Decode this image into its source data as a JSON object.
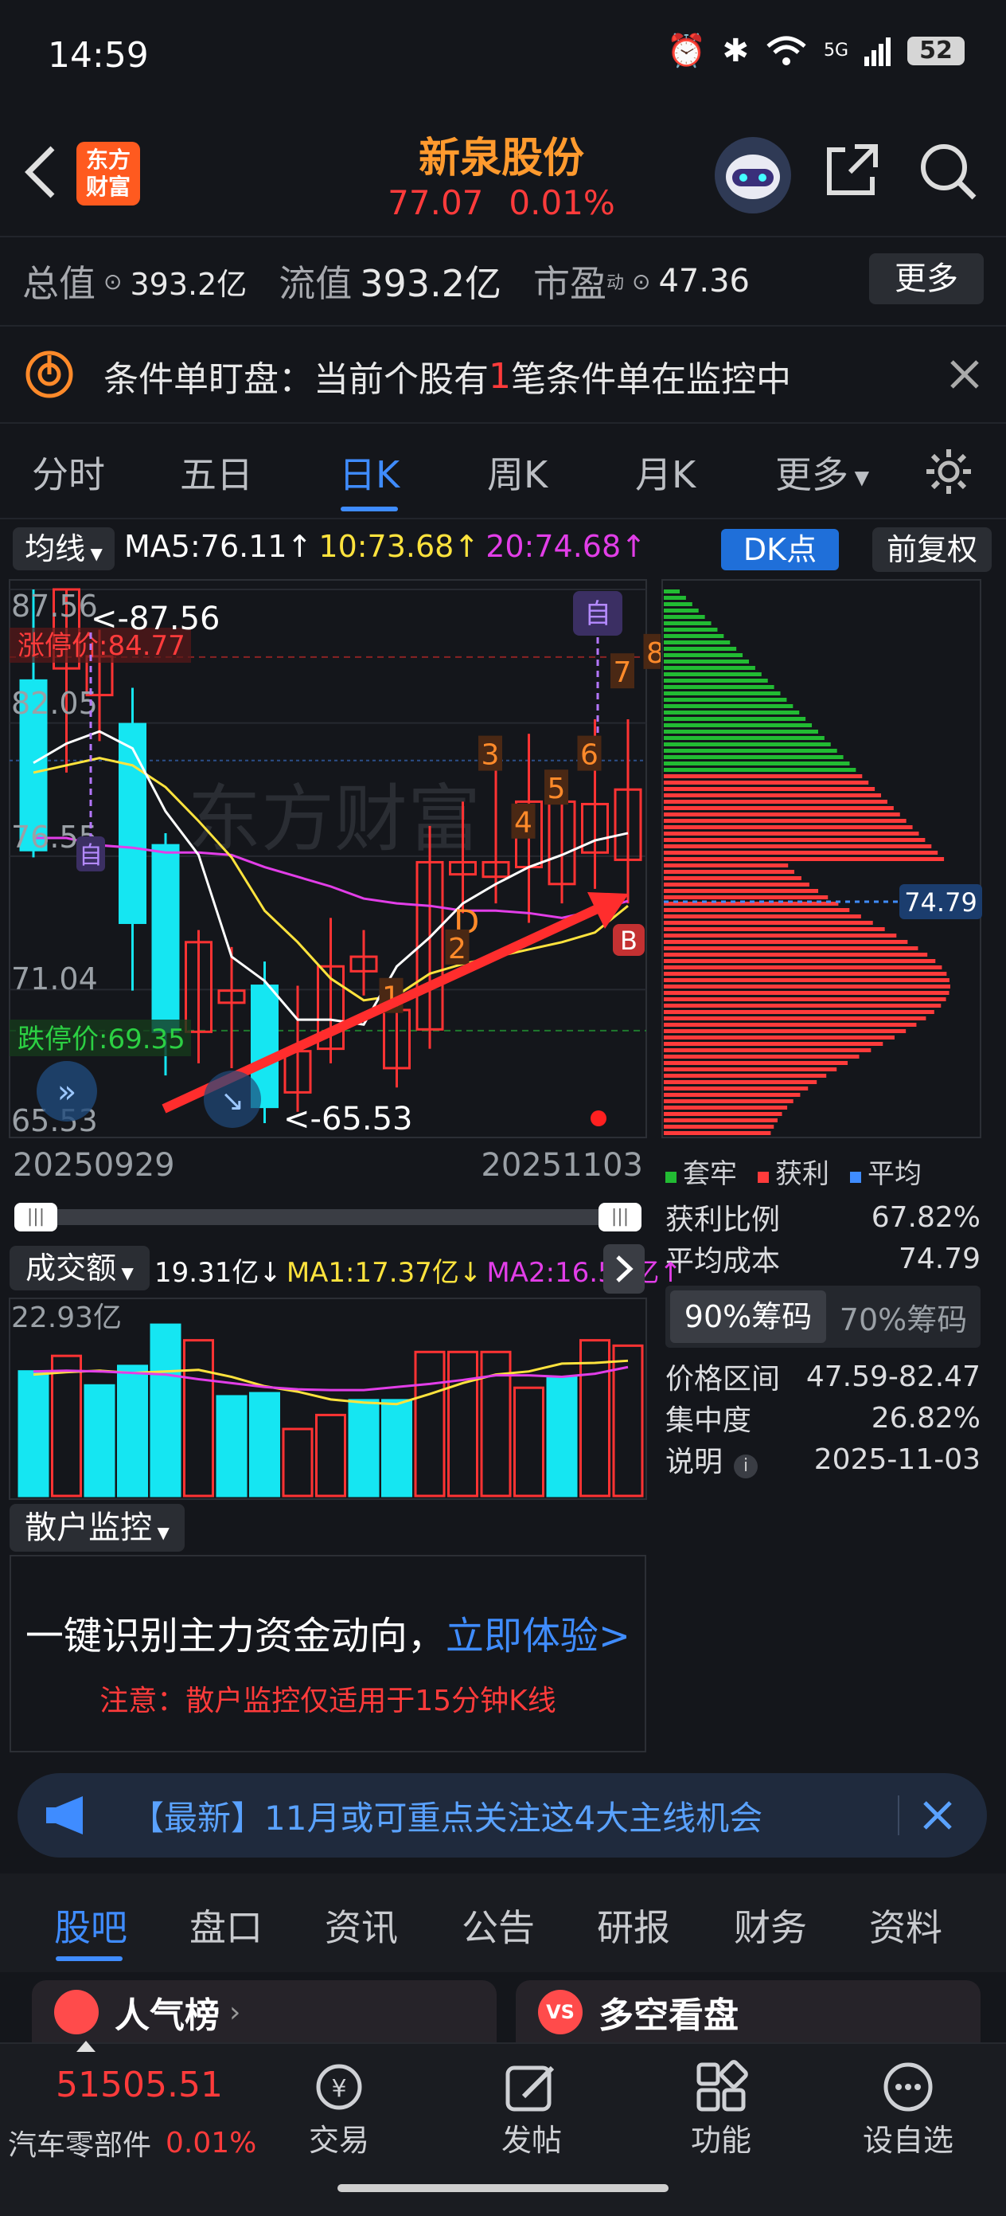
{
  "status_bar": {
    "time": "14:59",
    "battery": "52",
    "network": "5G"
  },
  "header": {
    "logo_text_top": "东方",
    "logo_text_bottom": "财富",
    "stock_name": "新泉股份",
    "price": "77.07",
    "change": "0.01%"
  },
  "stats": {
    "total_value_label": "总值",
    "total_value": "393.2亿",
    "float_value_label": "流值",
    "float_value": "393.2亿",
    "pe_label": "市盈",
    "pe_sup": "动",
    "pe_value": "47.36",
    "more_button": "更多"
  },
  "alert": {
    "text_prefix": "条件单盯盘：当前个股有",
    "count": "1",
    "text_suffix": "笔条件单在监控中"
  },
  "period_tabs": [
    "分时",
    "五日",
    "日K",
    "周K",
    "月K",
    "更多"
  ],
  "active_tab": 2,
  "ma_bar": {
    "ma_label": "均线",
    "ma5": "MA5:76.11↑",
    "ma10": "10:73.68↑",
    "ma20": "20:74.68↑",
    "dk_button": "DK点",
    "adjust_button": "前复权"
  },
  "kline": {
    "price_high": "87.56",
    "price_2": "82.05",
    "price_3": "76.55",
    "price_4": "71.04",
    "price_low": "65.53",
    "limit_up": "涨停价:84.77",
    "limit_down": "跌停价:69.35",
    "annot_high": "<-87.56",
    "annot_low": "<-65.53",
    "date_start": "20250929",
    "date_end": "20251103",
    "marker_zi": "自",
    "marker_d": "D",
    "marker_b": "B",
    "seq_labels": [
      "1",
      "2",
      "3",
      "4",
      "5",
      "6",
      "7",
      "8"
    ],
    "watermark": "东方财富"
  },
  "chart_data": {
    "type": "candlestick",
    "ylim": [
      65.53,
      87.56
    ],
    "candles": [
      {
        "o": 83.8,
        "h": 87.56,
        "l": 76.5,
        "c": 76.8
      },
      {
        "o": 84.3,
        "h": 87.56,
        "l": 80.0,
        "c": 87.56
      },
      {
        "o": 83.2,
        "h": 85.9,
        "l": 81.3,
        "c": 84.8
      },
      {
        "o": 82.0,
        "h": 83.5,
        "l": 71.0,
        "c": 73.8
      },
      {
        "o": 77.0,
        "h": 77.5,
        "l": 67.5,
        "c": 69.3
      },
      {
        "o": 69.3,
        "h": 73.5,
        "l": 68.0,
        "c": 73.0
      },
      {
        "o": 70.5,
        "h": 72.8,
        "l": 67.8,
        "c": 71.0
      },
      {
        "o": 71.2,
        "h": 72.2,
        "l": 65.53,
        "c": 66.2
      },
      {
        "o": 66.8,
        "h": 71.2,
        "l": 66.0,
        "c": 68.5
      },
      {
        "o": 68.6,
        "h": 74.0,
        "l": 68.0,
        "c": 72.0
      },
      {
        "o": 71.8,
        "h": 73.5,
        "l": 70.8,
        "c": 72.4
      },
      {
        "o": 67.8,
        "h": 70.8,
        "l": 67.0,
        "c": 70.2
      },
      {
        "o": 69.4,
        "h": 77.8,
        "l": 68.6,
        "c": 76.3
      },
      {
        "o": 75.8,
        "h": 78.8,
        "l": 74.2,
        "c": 76.3
      },
      {
        "o": 75.7,
        "h": 81.2,
        "l": 74.6,
        "c": 76.3
      },
      {
        "o": 76.1,
        "h": 81.6,
        "l": 73.8,
        "c": 78.8
      },
      {
        "o": 75.4,
        "h": 79.8,
        "l": 74.6,
        "c": 78.8
      },
      {
        "o": 76.7,
        "h": 82.2,
        "l": 75.2,
        "c": 78.7
      },
      {
        "o": 76.4,
        "h": 82.2,
        "l": 74.6,
        "c": 79.3
      }
    ],
    "ma5": [
      80.4,
      81.2,
      81.7,
      81.0,
      78.4,
      76.6,
      72.4,
      71.4,
      69.8,
      69.8,
      69.6,
      72.0,
      73.2,
      74.6,
      75.4,
      76.1,
      76.6,
      77.2,
      77.5
    ],
    "ma10": [
      80.0,
      80.3,
      80.6,
      80.3,
      79.4,
      78.0,
      76.5,
      74.3,
      73.0,
      71.5,
      70.6,
      70.8,
      71.7,
      72.1,
      72.4,
      72.7,
      73.0,
      73.4,
      74.5
    ],
    "ma20": [
      77.3,
      77.3,
      77.0,
      76.9,
      76.7,
      76.7,
      76.6,
      76.1,
      75.7,
      75.3,
      74.8,
      74.6,
      74.5,
      74.3,
      74.3,
      74.2,
      74.0,
      74.3,
      74.7
    ],
    "volume_label": "成交额",
    "volume_max": "22.93亿",
    "volume": [
      {
        "v": 16.0,
        "dir": "down"
      },
      {
        "v": 18.0,
        "dir": "up"
      },
      {
        "v": 14.2,
        "dir": "down"
      },
      {
        "v": 16.7,
        "dir": "down"
      },
      {
        "v": 22.0,
        "dir": "down"
      },
      {
        "v": 20.0,
        "dir": "up"
      },
      {
        "v": 12.8,
        "dir": "down"
      },
      {
        "v": 13.2,
        "dir": "down"
      },
      {
        "v": 8.6,
        "dir": "up"
      },
      {
        "v": 10.4,
        "dir": "up"
      },
      {
        "v": 12.3,
        "dir": "down"
      },
      {
        "v": 12.3,
        "dir": "down"
      },
      {
        "v": 18.5,
        "dir": "up"
      },
      {
        "v": 18.5,
        "dir": "up"
      },
      {
        "v": 18.5,
        "dir": "up"
      },
      {
        "v": 13.9,
        "dir": "up"
      },
      {
        "v": 15.2,
        "dir": "down"
      },
      {
        "v": 20.0,
        "dir": "up"
      },
      {
        "v": 19.31,
        "dir": "up"
      }
    ],
    "vol_ma1": [
      15.6,
      15.9,
      16.1,
      15.8,
      16.0,
      16.2,
      15.3,
      14.1,
      13.4,
      12.4,
      12.0,
      11.8,
      13.1,
      14.5,
      15.6,
      16.0,
      17.0,
      17.1,
      17.37
    ],
    "vol_ma2": [
      16.0,
      16.1,
      16.0,
      15.8,
      15.6,
      15.0,
      14.5,
      14.0,
      13.7,
      13.6,
      13.6,
      14.0,
      14.4,
      14.9,
      15.5,
      15.5,
      15.3,
      15.7,
      16.56
    ]
  },
  "chip": {
    "current_cost_tag": "74.79",
    "legend": [
      "套牢",
      "获利",
      "平均"
    ],
    "legend_colors": [
      "#22bb33",
      "#ff3b3b",
      "#3f8cff"
    ],
    "profit_ratio_label": "获利比例",
    "profit_ratio": "67.82%",
    "avg_cost_label": "平均成本",
    "avg_cost": "74.79",
    "tab_90": "90%筹码",
    "tab_70": "70%筹码",
    "range_label": "价格区间",
    "range_value": "47.59-82.47",
    "concentration_label": "集中度",
    "concentration_value": "26.82%",
    "note_label": "说明",
    "note_date": "2025-11-03"
  },
  "volume_bar": {
    "label": "成交额",
    "value": "19.31亿↓",
    "ma1": "MA1:17.37亿↓",
    "ma2": "MA2:16.56亿↑"
  },
  "retail": {
    "label": "散户监控",
    "headline_main": "一键识别主力资金动向，",
    "headline_link": "立即体验>",
    "note": "注意：散户监控仅适用于15分钟K线"
  },
  "news": {
    "text": "【最新】11月或可重点关注这4大主线机会"
  },
  "section_tabs": [
    "股吧",
    "盘口",
    "资讯",
    "公告",
    "研报",
    "财务",
    "资料"
  ],
  "cards": [
    {
      "title": "人气榜"
    },
    {
      "title": "多空看盘"
    }
  ],
  "bottom": {
    "index_value": "51505.51",
    "index_name": "汽车零部件",
    "index_change": "0.01%",
    "nav": [
      "交易",
      "发帖",
      "功能",
      "设自选"
    ]
  }
}
